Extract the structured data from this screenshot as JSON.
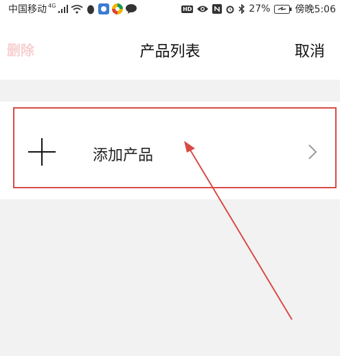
{
  "status_bar": {
    "carrier": "中国移动",
    "network": "4G",
    "battery": "27%",
    "time": "傍晚5:06",
    "hd": "HD"
  },
  "nav": {
    "left_label": "删除",
    "title": "产品列表",
    "right_label": "取消"
  },
  "list": {
    "add_label": "添加产品"
  },
  "colors": {
    "annotation": "#d94a45",
    "disabled_delete": "#f7d0d0"
  }
}
